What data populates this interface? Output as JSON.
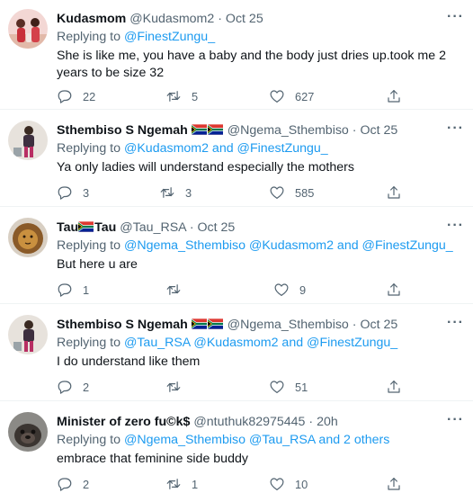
{
  "colors": {
    "link": "#1d9bf0",
    "secondary_text": "#536471",
    "primary_text": "#0f1419",
    "divider": "#eff3f4"
  },
  "tweets": [
    {
      "display_name": "Kudasmom",
      "handle": "@Kudasmom2",
      "separator": "·",
      "time": "Oct 25",
      "replying_prefix": "Replying to",
      "replying_text": "@FinestZungu_",
      "body": "She is like me, you have a baby and the body just dries up.took me 2 years to be size 32",
      "replies": "22",
      "retweets": "5",
      "likes": "627"
    },
    {
      "display_name": "Sthembiso S Ngemah",
      "handle": "@Ngema_Sthembiso",
      "separator": "·",
      "time": "Oct 25",
      "replying_prefix": "Replying to",
      "replying_text": "@Kudasmom2 and @FinestZungu_",
      "body": "Ya only ladies will understand especially the mothers",
      "replies": "3",
      "retweets": "3",
      "likes": "585"
    },
    {
      "name_part1": "Tau",
      "name_part2": "Tau",
      "handle": "@Tau_RSA",
      "separator": "·",
      "time": "Oct 25",
      "replying_prefix": "Replying to",
      "replying_text": "@Ngema_Sthembiso @Kudasmom2 and @FinestZungu_",
      "body": "But here u are",
      "replies": "1",
      "retweets": "",
      "likes": "9"
    },
    {
      "display_name": "Sthembiso S Ngemah",
      "handle": "@Ngema_Sthembiso",
      "separator": "·",
      "time": "Oct 25",
      "replying_prefix": "Replying to",
      "replying_text": "@Tau_RSA @Kudasmom2 and @FinestZungu_",
      "body": "I do understand like them",
      "replies": "2",
      "retweets": "",
      "likes": "51"
    },
    {
      "display_name": "Minister of zero fu©k$",
      "handle": "@ntuthuk82975445",
      "separator": "·",
      "time": "20h",
      "replying_prefix": "Replying to",
      "replying_text": "@Ngema_Sthembiso @Tau_RSA and 2 others",
      "body": "embrace that feminine side buddy",
      "replies": "2",
      "retweets": "1",
      "likes": "10"
    }
  ]
}
